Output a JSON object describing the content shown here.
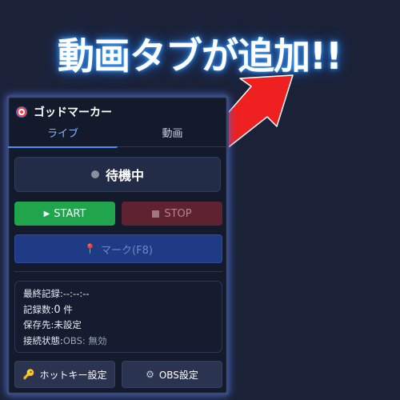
{
  "headline": "動画タブが追加!!",
  "app": {
    "title": "ゴッドマーカー"
  },
  "tabs": [
    {
      "label": "ライブ",
      "active": true
    },
    {
      "label": "動画",
      "active": false
    }
  ],
  "status": {
    "text": "待機中",
    "color": "#8a8f9c"
  },
  "buttons": {
    "start": "START",
    "stop": "STOP",
    "mark": "マーク(F8)",
    "hotkey": "ホットキー設定",
    "obs": "OBS設定"
  },
  "info": {
    "last_record_label": "最終記録:",
    "last_record_value": "--:--:--",
    "count_label": "記録数:",
    "count_value": "0",
    "count_unit": " 件",
    "save_label": "保存先:",
    "save_value": "未設定",
    "connection_label": "接続状態:",
    "connection_value": "OBS: 無効"
  },
  "colors": {
    "start": "#20a44c",
    "stop": "#5f2230",
    "mark": "#203b86",
    "arrow": "#ee2020",
    "accent": "#4d8df7"
  },
  "icons": [
    "target-icon",
    "play-icon",
    "stop-square-icon",
    "pin-icon",
    "key-icon",
    "gear-icon",
    "arrow-icon"
  ]
}
